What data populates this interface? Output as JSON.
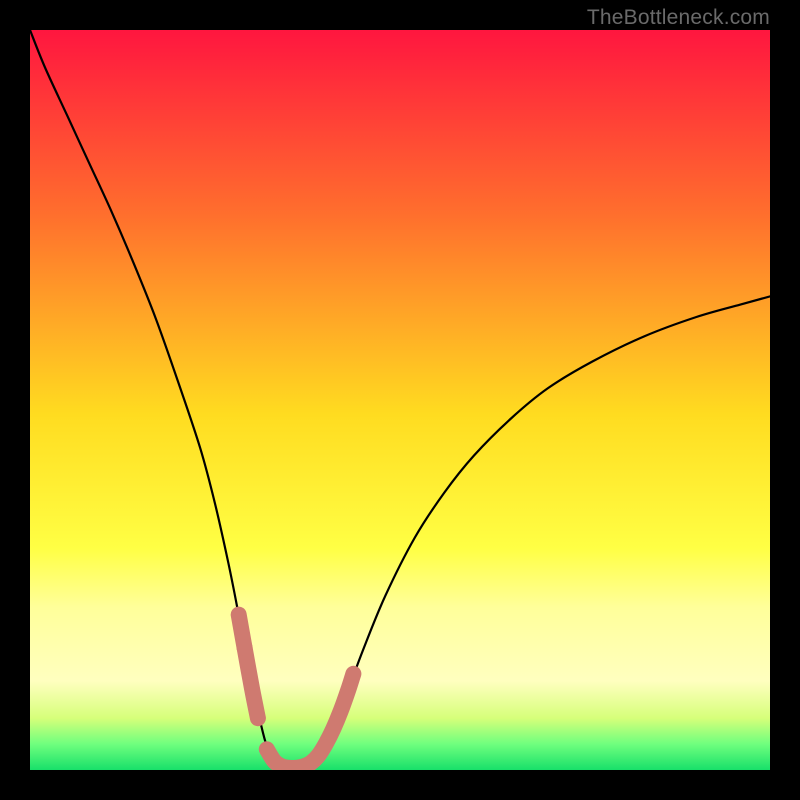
{
  "watermark": {
    "text": "TheBottleneck.com"
  },
  "colors": {
    "black": "#000000",
    "curve": "#000000",
    "marker": "#cf7a70",
    "watermark": "#6a6a6a"
  },
  "chart_data": {
    "type": "line",
    "title": "",
    "xlabel": "",
    "ylabel": "",
    "xlim": [
      0,
      100
    ],
    "ylim": [
      0,
      100
    ],
    "grid": false,
    "gradient_stops": [
      {
        "pct": 0,
        "color": "#ff163f"
      },
      {
        "pct": 25,
        "color": "#ff6f2d"
      },
      {
        "pct": 52,
        "color": "#ffdc20"
      },
      {
        "pct": 70,
        "color": "#ffff44"
      },
      {
        "pct": 78,
        "color": "#ffff9a"
      },
      {
        "pct": 88,
        "color": "#ffffbf"
      },
      {
        "pct": 93,
        "color": "#d6ff7a"
      },
      {
        "pct": 96.5,
        "color": "#6fff7e"
      },
      {
        "pct": 100,
        "color": "#18e06a"
      }
    ],
    "series": [
      {
        "name": "bottleneck-curve",
        "x": [
          0,
          2,
          5,
          8,
          11,
          14,
          17,
          20,
          23,
          25,
          26.8,
          28,
          29,
          30,
          31,
          31.7,
          32.3,
          33,
          34,
          35,
          36,
          37,
          38,
          39,
          40,
          41,
          42,
          43,
          45,
          48,
          52,
          56,
          60,
          65,
          70,
          76,
          83,
          90,
          96,
          100
        ],
        "y": [
          100,
          95,
          88.5,
          82,
          75.5,
          68.5,
          61,
          52.5,
          43.5,
          36,
          28,
          22,
          16.5,
          11,
          7,
          4.2,
          2.4,
          1.2,
          0.5,
          0.3,
          0.3,
          0.5,
          1.0,
          2.0,
          3.6,
          5.6,
          8.0,
          10.8,
          16.2,
          23.5,
          31.4,
          37.5,
          42.5,
          47.5,
          51.6,
          55.2,
          58.6,
          61.2,
          62.9,
          64
        ]
      }
    ],
    "markers": {
      "name": "highlight-band",
      "color": "#cf7a70",
      "segments": [
        {
          "x": [
            28.2,
            29.0,
            30.0,
            30.8
          ],
          "y": [
            21.0,
            16.5,
            11.0,
            7.0
          ]
        },
        {
          "x": [
            32.0,
            33.0,
            34.0,
            35.0,
            36.0,
            37.0,
            38.0,
            39.0,
            40.0,
            41.0,
            42.0,
            43.0,
            43.7
          ],
          "y": [
            2.8,
            1.2,
            0.5,
            0.3,
            0.3,
            0.5,
            1.0,
            2.0,
            3.6,
            5.6,
            8.0,
            10.8,
            13.0
          ]
        }
      ],
      "dots": [
        {
          "x": 29.0,
          "y": 16.5
        }
      ]
    }
  }
}
